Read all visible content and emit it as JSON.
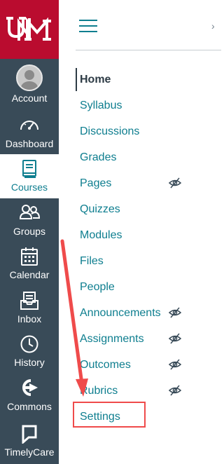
{
  "global_nav": {
    "logo_icon": "unm-logo-icon",
    "brand_color": "#ba0c2f",
    "background_color": "#394b58",
    "active_color": "#0e7e8f",
    "items": [
      {
        "label": "Account",
        "icon": "account-avatar-icon"
      },
      {
        "label": "Dashboard",
        "icon": "dashboard-gauge-icon"
      },
      {
        "label": "Courses",
        "icon": "courses-book-icon",
        "active": true
      },
      {
        "label": "Groups",
        "icon": "groups-people-icon"
      },
      {
        "label": "Calendar",
        "icon": "calendar-icon"
      },
      {
        "label": "Inbox",
        "icon": "inbox-icon"
      },
      {
        "label": "History",
        "icon": "history-clock-icon"
      },
      {
        "label": "Commons",
        "icon": "commons-arrow-icon"
      },
      {
        "label": "TimelyCare",
        "icon": "timelycare-chat-icon"
      }
    ]
  },
  "course_header": {
    "menu_icon": "hamburger-menu-icon",
    "breadcrumb_icon": "chevron-right-icon"
  },
  "course_nav": {
    "link_color": "#0e7e8f",
    "items": [
      {
        "label": "Home",
        "active": true,
        "hidden_from_students": false
      },
      {
        "label": "Syllabus",
        "hidden_from_students": false
      },
      {
        "label": "Discussions",
        "hidden_from_students": false
      },
      {
        "label": "Grades",
        "hidden_from_students": false
      },
      {
        "label": "Pages",
        "hidden_from_students": true
      },
      {
        "label": "Quizzes",
        "hidden_from_students": false
      },
      {
        "label": "Modules",
        "hidden_from_students": false
      },
      {
        "label": "Files",
        "hidden_from_students": false
      },
      {
        "label": "People",
        "hidden_from_students": false
      },
      {
        "label": "Announcements",
        "hidden_from_students": true
      },
      {
        "label": "Assignments",
        "hidden_from_students": true
      },
      {
        "label": "Outcomes",
        "hidden_from_students": true
      },
      {
        "label": "Rubrics",
        "hidden_from_students": true
      },
      {
        "label": "Settings",
        "hidden_from_students": false,
        "highlighted": true
      }
    ]
  },
  "annotation": {
    "highlight_color": "#ef4b4b",
    "target": "Settings"
  }
}
